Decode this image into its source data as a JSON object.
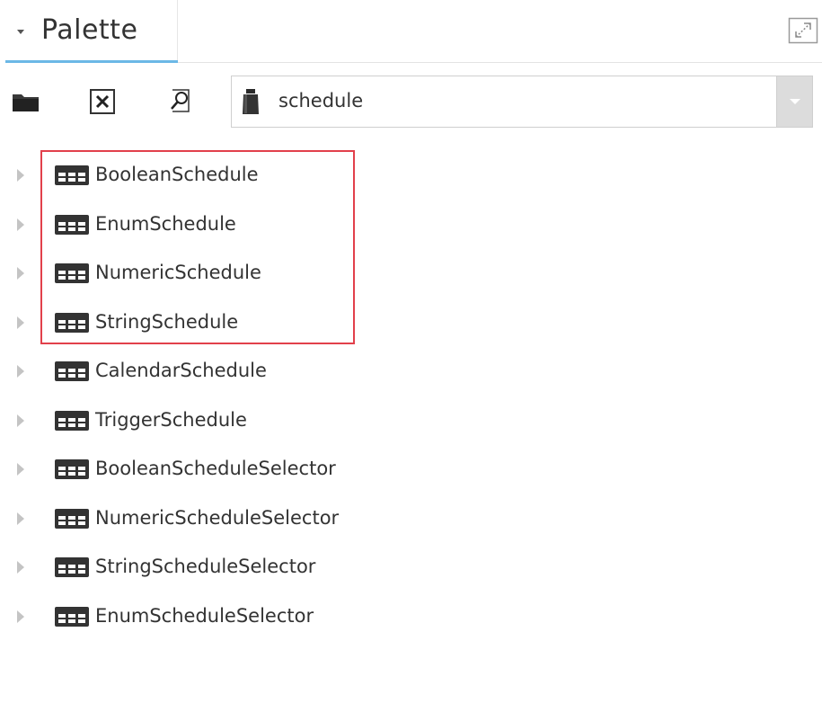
{
  "panel": {
    "title": "Palette",
    "maximize_icon": "maximize-icon",
    "collapse_icon": "caret-down-icon"
  },
  "toolbar": {
    "folder_icon": "folder-icon",
    "close_icon": "close-box-icon",
    "find_icon": "find-icon",
    "palette_select": {
      "value": "schedule",
      "icon": "module-jar-icon"
    }
  },
  "tree": {
    "items": [
      {
        "label": "BooleanSchedule",
        "icon": "schedule-grid-icon"
      },
      {
        "label": "EnumSchedule",
        "icon": "schedule-grid-icon"
      },
      {
        "label": "NumericSchedule",
        "icon": "schedule-grid-icon"
      },
      {
        "label": "StringSchedule",
        "icon": "schedule-grid-icon"
      },
      {
        "label": "CalendarSchedule",
        "icon": "schedule-grid-icon"
      },
      {
        "label": "TriggerSchedule",
        "icon": "schedule-grid-icon"
      },
      {
        "label": "BooleanScheduleSelector",
        "icon": "schedule-grid-icon"
      },
      {
        "label": "NumericScheduleSelector",
        "icon": "schedule-grid-icon"
      },
      {
        "label": "StringScheduleSelector",
        "icon": "schedule-grid-icon"
      },
      {
        "label": "EnumScheduleSelector",
        "icon": "schedule-grid-icon"
      }
    ]
  },
  "colors": {
    "highlight": "#e2404b",
    "tab_accent": "#6cb8e6",
    "icon_dark": "#2b2b2b"
  }
}
